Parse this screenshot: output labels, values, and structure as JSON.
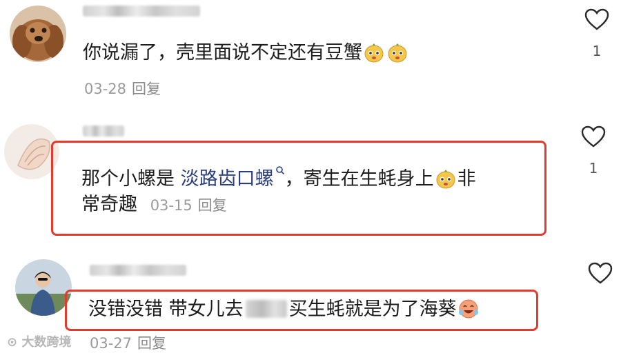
{
  "comments": [
    {
      "text": "你说漏了，壳里面说不定还有豆蟹",
      "date": "03-28",
      "reply_label": "回复",
      "like_count": "1"
    },
    {
      "text_before": "那个小螺是 ",
      "link_text": "淡路齿口螺",
      "text_middle": "，寄生在生蚝身上",
      "text_after": "非",
      "text_line2": "常奇趣",
      "date": "03-15",
      "reply_label": "回复",
      "like_count": "1"
    },
    {
      "text_before": "没错没错 带女儿去",
      "text_after": "买生蚝就是为了海葵",
      "date": "03-27",
      "reply_label": "回复",
      "like_count": ""
    }
  ],
  "watermark": "大数跨境",
  "colors": {
    "highlight": "#e03b2d",
    "link": "#2b3f80",
    "meta": "#9a9a9a"
  }
}
